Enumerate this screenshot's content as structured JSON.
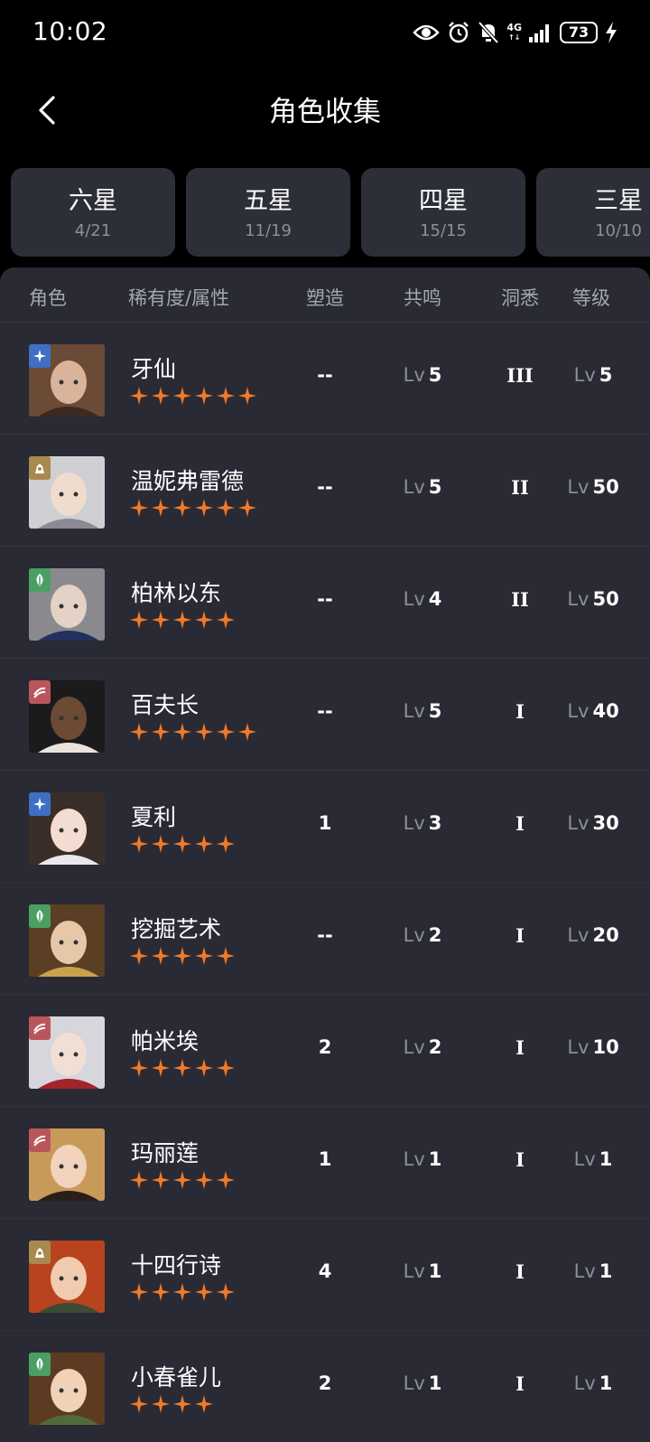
{
  "status_bar": {
    "time": "10:02",
    "network": "4G",
    "battery": "73",
    "icons": [
      "eye-icon",
      "alarm-icon",
      "bell-off-icon",
      "signal-icon",
      "battery-icon",
      "charging-icon"
    ]
  },
  "header": {
    "title": "角色收集",
    "back_icon": "chevron-left-icon"
  },
  "tabs": [
    {
      "label": "六星",
      "count": "4/21"
    },
    {
      "label": "五星",
      "count": "11/19"
    },
    {
      "label": "四星",
      "count": "15/15"
    },
    {
      "label": "三星",
      "count": "10/10"
    }
  ],
  "table": {
    "columns": {
      "character": "角色",
      "rarity": "稀有度/属性",
      "shaping": "塑造",
      "resonance": "共鸣",
      "insight": "洞悉",
      "level": "等级"
    },
    "lv_prefix": "Lv",
    "rows": [
      {
        "name": "牙仙",
        "element": "star",
        "stars": 6,
        "shaping": "--",
        "resonance": "5",
        "insight": "III",
        "level": "5"
      },
      {
        "name": "温妮弗雷德",
        "element": "beast",
        "stars": 6,
        "shaping": "--",
        "resonance": "5",
        "insight": "II",
        "level": "50"
      },
      {
        "name": "柏林以东",
        "element": "plant",
        "stars": 5,
        "shaping": "--",
        "resonance": "4",
        "insight": "II",
        "level": "50"
      },
      {
        "name": "百夫长",
        "element": "mineral",
        "stars": 6,
        "shaping": "--",
        "resonance": "5",
        "insight": "I",
        "level": "40"
      },
      {
        "name": "夏利",
        "element": "star",
        "stars": 5,
        "shaping": "1",
        "resonance": "3",
        "insight": "I",
        "level": "30"
      },
      {
        "name": "挖掘艺术",
        "element": "plant",
        "stars": 5,
        "shaping": "--",
        "resonance": "2",
        "insight": "I",
        "level": "20"
      },
      {
        "name": "帕米埃",
        "element": "mineral",
        "stars": 5,
        "shaping": "2",
        "resonance": "2",
        "insight": "I",
        "level": "10"
      },
      {
        "name": "玛丽莲",
        "element": "mineral",
        "stars": 5,
        "shaping": "1",
        "resonance": "1",
        "insight": "I",
        "level": "1"
      },
      {
        "name": "十四行诗",
        "element": "beast",
        "stars": 5,
        "shaping": "4",
        "resonance": "1",
        "insight": "I",
        "level": "1"
      },
      {
        "name": "小春雀儿",
        "element": "plant",
        "stars": 4,
        "shaping": "2",
        "resonance": "1",
        "insight": "I",
        "level": "1"
      }
    ]
  },
  "colors": {
    "background": "#000000",
    "panel": "#292a33",
    "tab": "#2d2f38",
    "star": "#f07a2c",
    "element_star": "#3f6fc4",
    "element_beast": "#a88a4e",
    "element_plant": "#4aa063",
    "element_mineral": "#b9565b"
  }
}
